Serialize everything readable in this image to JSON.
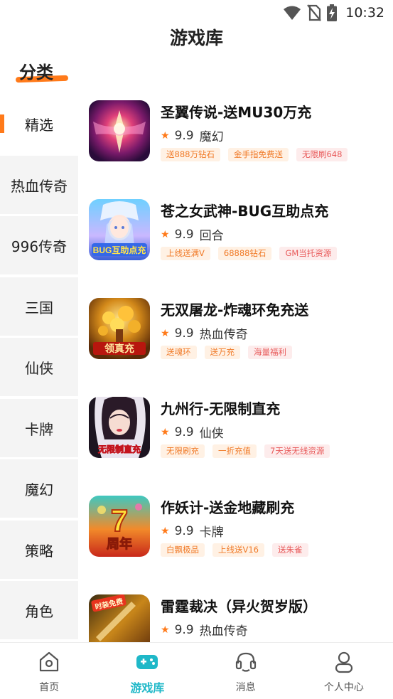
{
  "status_bar": {
    "time": "10:32",
    "icons": [
      "wifi-icon",
      "no-sim-icon",
      "battery-charging-icon"
    ]
  },
  "page_title": "游戏库",
  "category_header": "分类",
  "categories": [
    {
      "label": "精选",
      "active": true
    },
    {
      "label": "热血传奇",
      "active": false
    },
    {
      "label": "996传奇",
      "active": false
    },
    {
      "label": "三国",
      "active": false
    },
    {
      "label": "仙侠",
      "active": false
    },
    {
      "label": "卡牌",
      "active": false
    },
    {
      "label": "魔幻",
      "active": false
    },
    {
      "label": "策略",
      "active": false
    },
    {
      "label": "角色",
      "active": false
    }
  ],
  "games": [
    {
      "name": "圣翼传说-送MU30万充",
      "rating": "9.9",
      "genre": "魔幻",
      "tags": [
        {
          "text": "送888万钻石",
          "color": "orange"
        },
        {
          "text": "金手指免费送",
          "color": "orange"
        },
        {
          "text": "无限刷648",
          "color": "red"
        }
      ]
    },
    {
      "name": "苍之女武神-BUG互助点充",
      "rating": "9.9",
      "genre": "回合",
      "tags": [
        {
          "text": "上线送满V",
          "color": "orange"
        },
        {
          "text": "68888钻石",
          "color": "orange"
        },
        {
          "text": "GM当托资源",
          "color": "red"
        }
      ]
    },
    {
      "name": "无双屠龙-炸魂环免充送",
      "rating": "9.9",
      "genre": "热血传奇",
      "tags": [
        {
          "text": "送魂环",
          "color": "orange"
        },
        {
          "text": "送万充",
          "color": "orange"
        },
        {
          "text": "海量福利",
          "color": "red"
        }
      ]
    },
    {
      "name": "九州行-无限制直充",
      "rating": "9.9",
      "genre": "仙侠",
      "tags": [
        {
          "text": "无限刷充",
          "color": "orange"
        },
        {
          "text": "一折充值",
          "color": "orange"
        },
        {
          "text": "7天送无线资源",
          "color": "red"
        }
      ]
    },
    {
      "name": "作妖计-送金地藏刷充",
      "rating": "9.9",
      "genre": "卡牌",
      "tags": [
        {
          "text": "白飘极品",
          "color": "orange"
        },
        {
          "text": "上线送V16",
          "color": "orange"
        },
        {
          "text": "送朱雀",
          "color": "red"
        }
      ]
    },
    {
      "name": "雷霆裁决（异火贺岁版）",
      "rating": "9.9",
      "genre": "热血传奇",
      "tags": []
    }
  ],
  "game_icon_captions": {
    "game_2": "BUG互助点充",
    "game_3": "领真充",
    "game_4": "无限制直充",
    "game_5": "7",
    "game_5_sub": "周年",
    "game_6": "时装免费"
  },
  "tabs": [
    {
      "label": "首页",
      "icon": "home-icon",
      "active": false
    },
    {
      "label": "游戏库",
      "icon": "gamepad-icon",
      "active": true
    },
    {
      "label": "消息",
      "icon": "headset-icon",
      "active": false
    },
    {
      "label": "个人中心",
      "icon": "person-icon",
      "active": false
    }
  ],
  "colors": {
    "accent": "#ff7a1a",
    "tab_active": "#1fb8c8",
    "sidebar_bg": "#f4f4f4"
  }
}
